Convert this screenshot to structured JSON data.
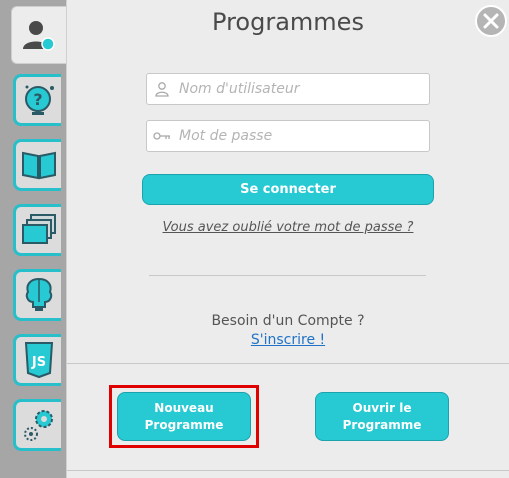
{
  "title": "Programmes",
  "login": {
    "username_placeholder": "Nom d'utilisateur",
    "password_placeholder": "Mot de passe",
    "connect_label": "Se connecter",
    "forgot_label": "Vous avez oublié votre mot de passe ?"
  },
  "signup": {
    "prompt": "Besoin d'un Compte ?",
    "link": "S'inscrire !"
  },
  "actions": {
    "new_program": "Nouveau Programme",
    "open_program": "Ouvrir le Programme"
  },
  "sidebar": {
    "tabs": [
      {
        "icon": "user-icon",
        "active": true
      },
      {
        "icon": "help-icon"
      },
      {
        "icon": "book-icon"
      },
      {
        "icon": "windows-icon"
      },
      {
        "icon": "brain-icon"
      },
      {
        "icon": "js-icon"
      },
      {
        "icon": "settings-icon"
      }
    ]
  },
  "colors": {
    "accent": "#27c9d3",
    "highlight": "#e00000",
    "link": "#1f73c7"
  }
}
